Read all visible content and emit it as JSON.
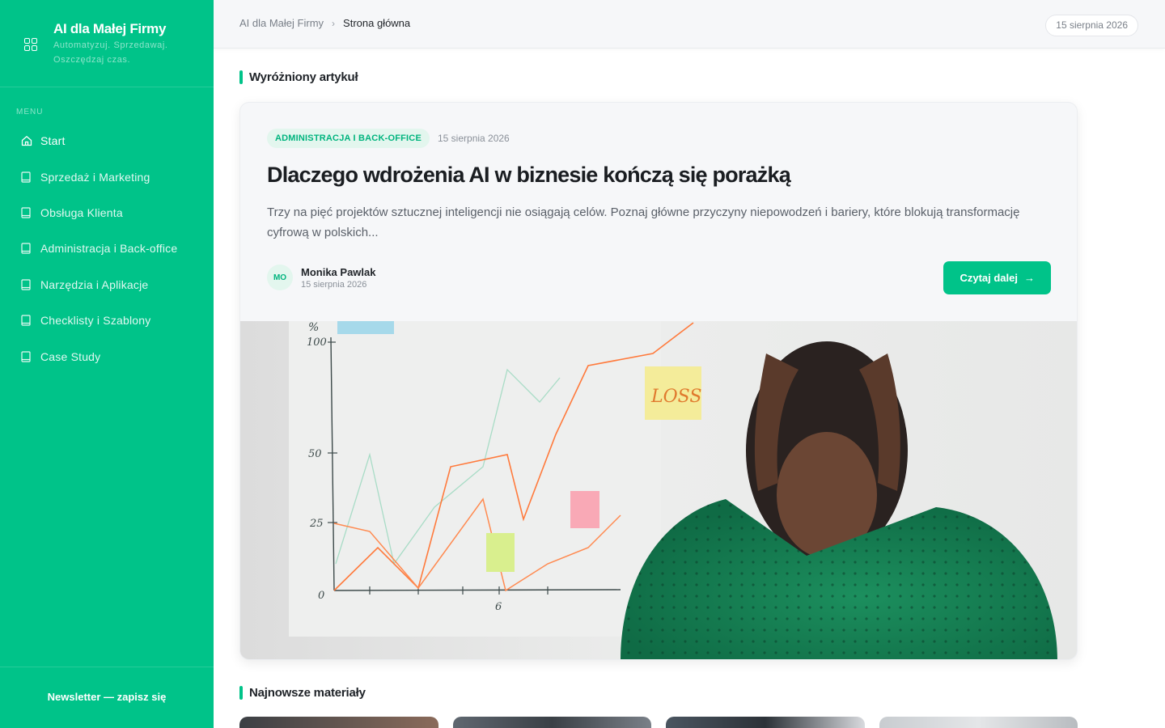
{
  "sidebar": {
    "brand_title": "AI dla Małej Firmy",
    "brand_tagline": "Automatyzuj. Sprzedawaj. Oszczędzaj czas.",
    "menu_label": "MENU",
    "items": [
      {
        "label": "Start",
        "icon": "home-icon",
        "active": true
      },
      {
        "label": "Sprzedaż i Marketing",
        "icon": "book-icon"
      },
      {
        "label": "Obsługa Klienta",
        "icon": "book-icon"
      },
      {
        "label": "Administracja i Back-office",
        "icon": "book-icon"
      },
      {
        "label": "Narzędzia i Aplikacje",
        "icon": "book-icon"
      },
      {
        "label": "Checklisty i Szablony",
        "icon": "book-icon"
      },
      {
        "label": "Case Study",
        "icon": "book-icon"
      }
    ],
    "newsletter_label": "Newsletter — zapisz się"
  },
  "topbar": {
    "breadcrumb": {
      "home": "AI dla Małej Firmy",
      "current": "Strona główna"
    },
    "date": "15 sierpnia 2026"
  },
  "featured": {
    "section_title": "Wyróżniony artykuł",
    "tag": "ADMINISTRACJA I BACK-OFFICE",
    "date": "15 sierpnia 2026",
    "title": "Dlaczego wdrożenia AI w biznesie kończą się porażką",
    "excerpt": "Trzy na pięć projektów sztucznej inteligencji nie osiągają celów. Poznaj główne przyczyny niepowodzeń i bariery, które blokują transformację cyfrową w polskich...",
    "author_initials": "MO",
    "author_name": "Monika Pawlak",
    "author_date": "15 sierpnia 2026",
    "cta_label": "Czytaj dalej",
    "image": {
      "chart_ticks": [
        "%",
        "100",
        "50",
        "25",
        "0",
        "6"
      ],
      "sticky_note": "LOSS"
    }
  },
  "latest": {
    "section_title": "Najnowsze materiały"
  },
  "colors": {
    "accent": "#00c389",
    "tag_bg": "#e3f6ee",
    "tag_text": "#00b47e"
  }
}
